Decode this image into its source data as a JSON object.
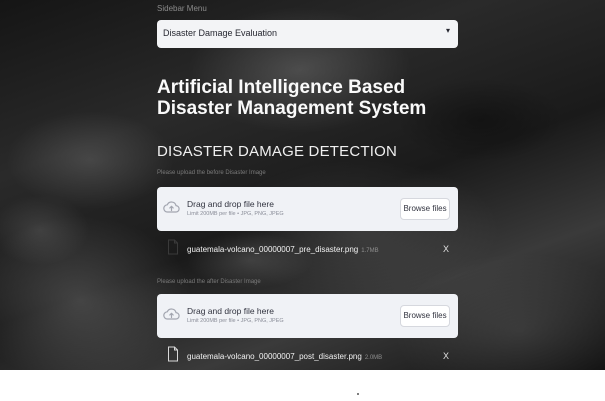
{
  "select": {
    "label": "Sidebar Menu",
    "value": "Disaster Damage Evaluation",
    "caret": "▾"
  },
  "page": {
    "title": "Artificial Intelligence Based Disaster Management System",
    "subtitle": "DISASTER DAMAGE DETECTION"
  },
  "uploader_pre": {
    "label": "Please upload the before Disaster Image",
    "drag_text": "Drag and drop file here",
    "limit_text": "Limit 200MB per file • JPG, PNG, JPEG",
    "browse_label": "Browse files",
    "file": {
      "name": "guatemala-volcano_00000007_pre_disaster.png",
      "size": "1.7MB",
      "close": "X"
    }
  },
  "uploader_post": {
    "label": "Please upload the after Disaster Image",
    "drag_text": "Drag and drop file here",
    "limit_text": "Limit 200MB per file • JPG, PNG, JPEG",
    "browse_label": "Browse files",
    "file": {
      "name": "guatemala-volcano_00000007_post_disaster.png",
      "size": "2.0MB",
      "close": "X"
    }
  },
  "icons": {
    "upload": "cloud-upload-icon",
    "file": "file-icon",
    "caret": "chevron-down-icon"
  },
  "colors": {
    "widget_bg": "#f0f2f6",
    "text_dark": "#31333f",
    "text_light": "#fafafa"
  }
}
